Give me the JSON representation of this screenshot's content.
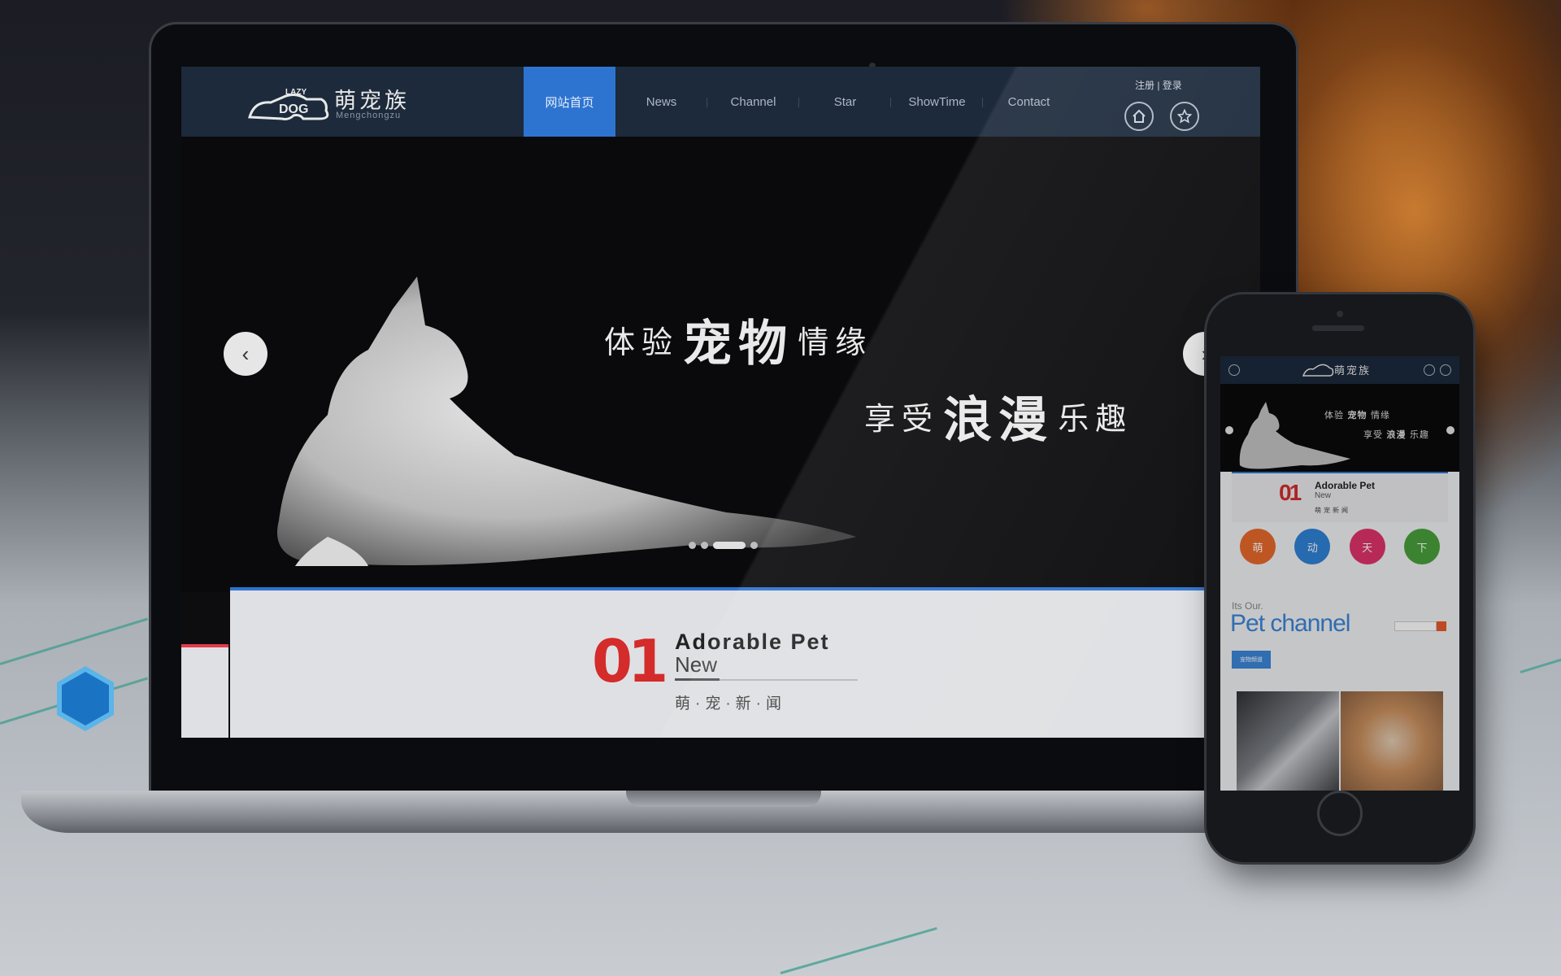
{
  "brand": {
    "logo_text": "LAZY DOG",
    "name_cn": "萌宠族",
    "name_en": "Mengchongzu"
  },
  "nav": {
    "items": [
      {
        "label": "网站首页",
        "active": true
      },
      {
        "label": "News",
        "active": false
      },
      {
        "label": "Channel",
        "active": false
      },
      {
        "label": "Star",
        "active": false
      },
      {
        "label": "ShowTime",
        "active": false
      },
      {
        "label": "Contact",
        "active": false
      }
    ],
    "auth": "注册 | 登录",
    "icons": [
      "home-icon",
      "star-icon"
    ]
  },
  "hero": {
    "line1_a": "体验",
    "line1_b": "宠物",
    "line1_c": "情缘",
    "line2_a": "享受",
    "line2_b": "浪漫",
    "line2_c": "乐趣",
    "prev": "‹",
    "next": "›"
  },
  "section": {
    "number": "01",
    "title": "Adorable Pet",
    "subtitle": "New",
    "cn": "萌·宠·新·闻"
  },
  "phone": {
    "card_title": "Adorable Pet",
    "card_sub": "New",
    "card_cn": "萌宠新闻",
    "circles": [
      {
        "char": "萌",
        "color": "#e86a2c"
      },
      {
        "char": "动",
        "color": "#2f82d6"
      },
      {
        "char": "天",
        "color": "#e0336b"
      },
      {
        "char": "下",
        "color": "#49a03c"
      }
    ],
    "its_our": "Its Our.",
    "pet_channel": "Pet channel",
    "tabs_active": "宠物频道"
  },
  "colors": {
    "accent_blue": "#2d74d1",
    "header_bg": "#1c2a3c",
    "accent_red": "#d42b2b"
  }
}
